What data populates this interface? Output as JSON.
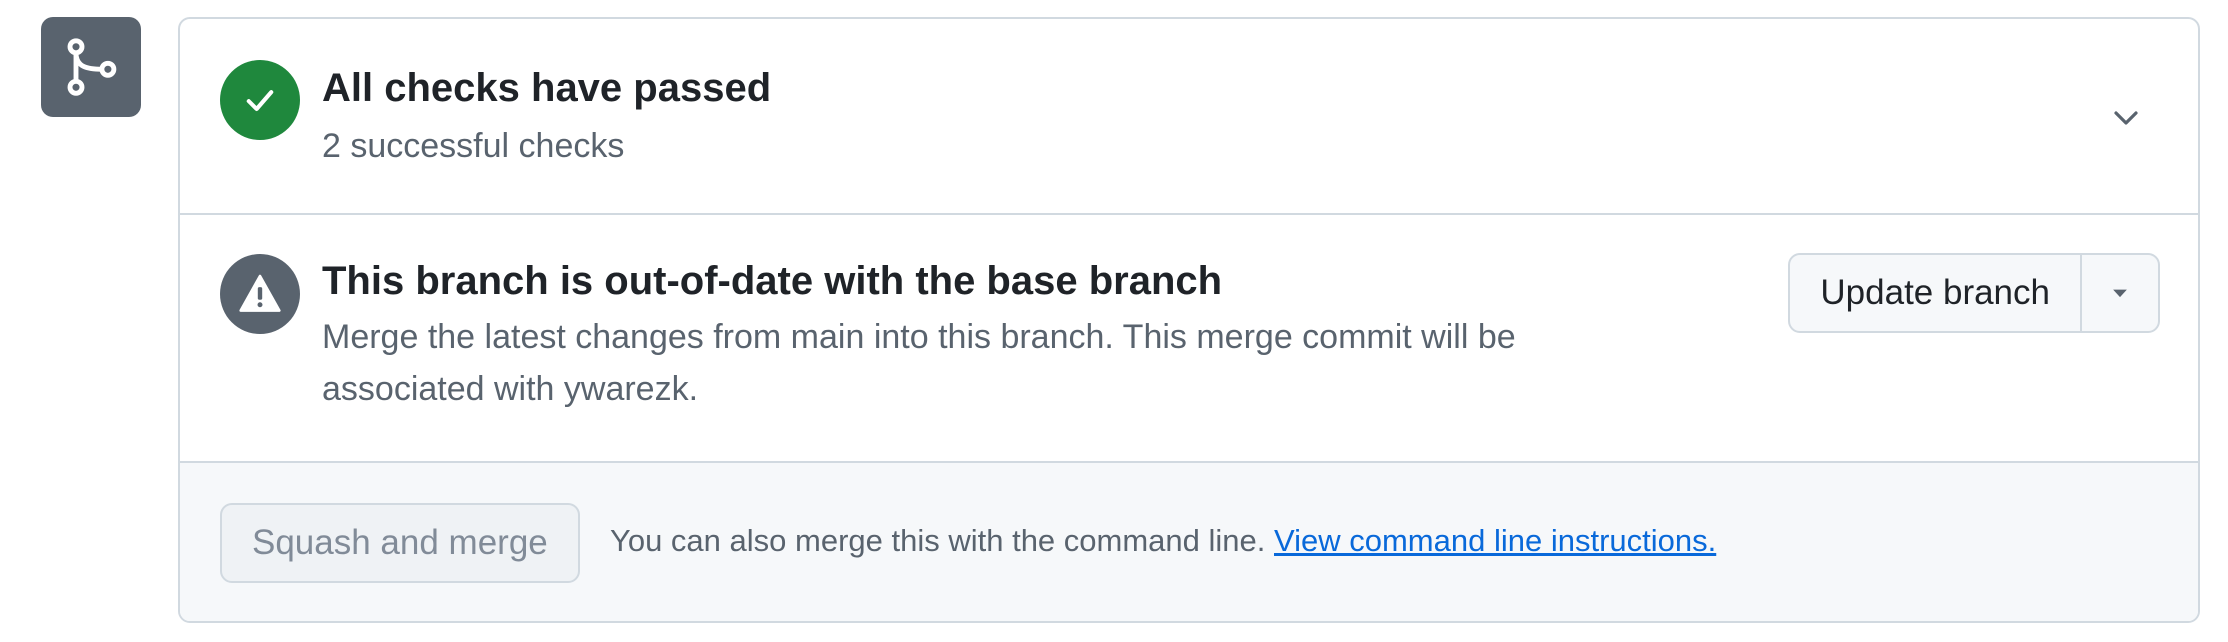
{
  "icons": {
    "merge_badge": "git-merge-icon",
    "checks_status": "check-icon",
    "branch_status": "alert-icon",
    "expand": "chevron-down-icon",
    "dropdown": "triangle-down-icon"
  },
  "colors": {
    "success": "#1f883d",
    "neutral": "#59636e",
    "link": "#0969da",
    "border": "#d1d9e0"
  },
  "checks": {
    "title": "All checks have passed",
    "subtitle": "2 successful checks"
  },
  "branch": {
    "title": "This branch is out-of-date with the base branch",
    "description": "Merge the latest changes from main into this branch. This merge commit will be associated with ywarezk.",
    "update_button_label": "Update branch"
  },
  "merge": {
    "button_label": "Squash and merge",
    "note": "You can also merge this with the command line.",
    "link_text": "View command line instructions."
  }
}
